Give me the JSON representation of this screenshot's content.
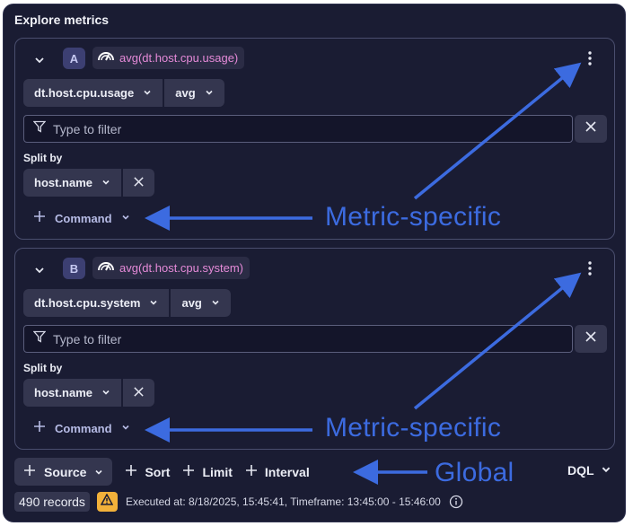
{
  "panel": {
    "title": "Explore metrics"
  },
  "queries": [
    {
      "letter": "A",
      "expression": "avg(dt.host.cpu.usage)",
      "metric": "dt.host.cpu.usage",
      "aggregation": "avg",
      "filter_placeholder": "Type to filter",
      "split_label": "Split by",
      "split_value": "host.name",
      "command_label": "Command"
    },
    {
      "letter": "B",
      "expression": "avg(dt.host.cpu.system)",
      "metric": "dt.host.cpu.system",
      "aggregation": "avg",
      "filter_placeholder": "Type to filter",
      "split_label": "Split by",
      "split_value": "host.name",
      "command_label": "Command"
    }
  ],
  "toolbar": {
    "source_label": "Source",
    "sort_label": "Sort",
    "limit_label": "Limit",
    "interval_label": "Interval",
    "dql_label": "DQL"
  },
  "status": {
    "records": "490 records",
    "executed": "Executed at: 8/18/2025, 15:45:41, Timeframe: 13:45:00 - 15:46:00"
  },
  "annotations": {
    "metric_a": "Metric-specific",
    "metric_b": "Metric-specific",
    "global": "Global"
  },
  "colors": {
    "background": "#1a1c33",
    "expression_text": "#e58ad8",
    "annotation": "#3c6be0",
    "warning": "#f2b13a"
  }
}
